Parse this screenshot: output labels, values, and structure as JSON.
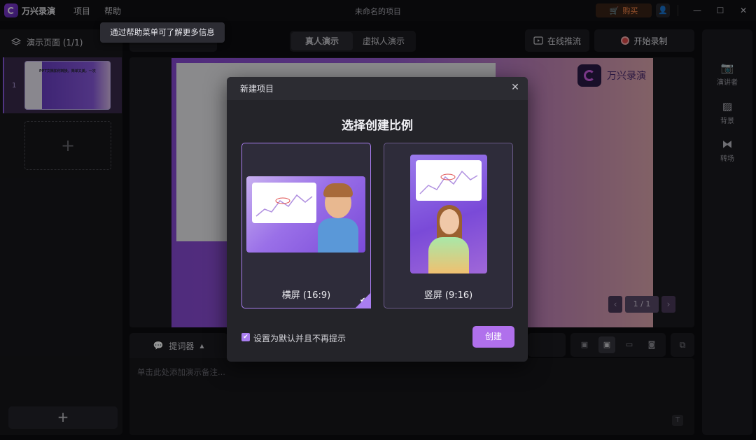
{
  "app": {
    "name": "万兴录演",
    "window_title": "未命名的项目",
    "buy_label": "购买"
  },
  "menu": {
    "items": [
      "项目",
      "帮助"
    ]
  },
  "tooltip": "通过帮助菜单可了解更多信息",
  "window_controls": {
    "minimize": "—",
    "maximize": "☐",
    "close": "✕"
  },
  "sidebar": {
    "title": "演示页面 (1/1)",
    "slide_number": "1",
    "add_symbol": "+",
    "thumb_title": "PPT文档如何转换，简单又美，一次"
  },
  "toolbar": {
    "tabs": [
      "真人演示",
      "虚拟人演示"
    ],
    "active_tab": 0,
    "stream_label": "在线推流",
    "record_label": "开始录制"
  },
  "slide": {
    "brand": "万兴录演",
    "page": "1 / 1"
  },
  "notes": {
    "tab_label": "提词器",
    "placeholder": "单击此处添加演示备注..."
  },
  "right_panel": {
    "items": [
      {
        "label": "演讲者",
        "icon": "presenter-camera-icon"
      },
      {
        "label": "背景",
        "icon": "background-icon"
      },
      {
        "label": "转场",
        "icon": "transition-icon"
      }
    ]
  },
  "dialog": {
    "title": "新建项目",
    "heading": "选择创建比例",
    "options": [
      {
        "label": "横屏 (16:9)",
        "selected": true
      },
      {
        "label": "竖屏 (9:16)",
        "selected": false
      }
    ],
    "default_checkbox": {
      "label": "设置为默认并且不再提示",
      "checked": true
    },
    "create_label": "创建"
  },
  "colors": {
    "accent": "#a97ef0",
    "record": "#e04a4a",
    "buy": "#ff8a4a"
  }
}
